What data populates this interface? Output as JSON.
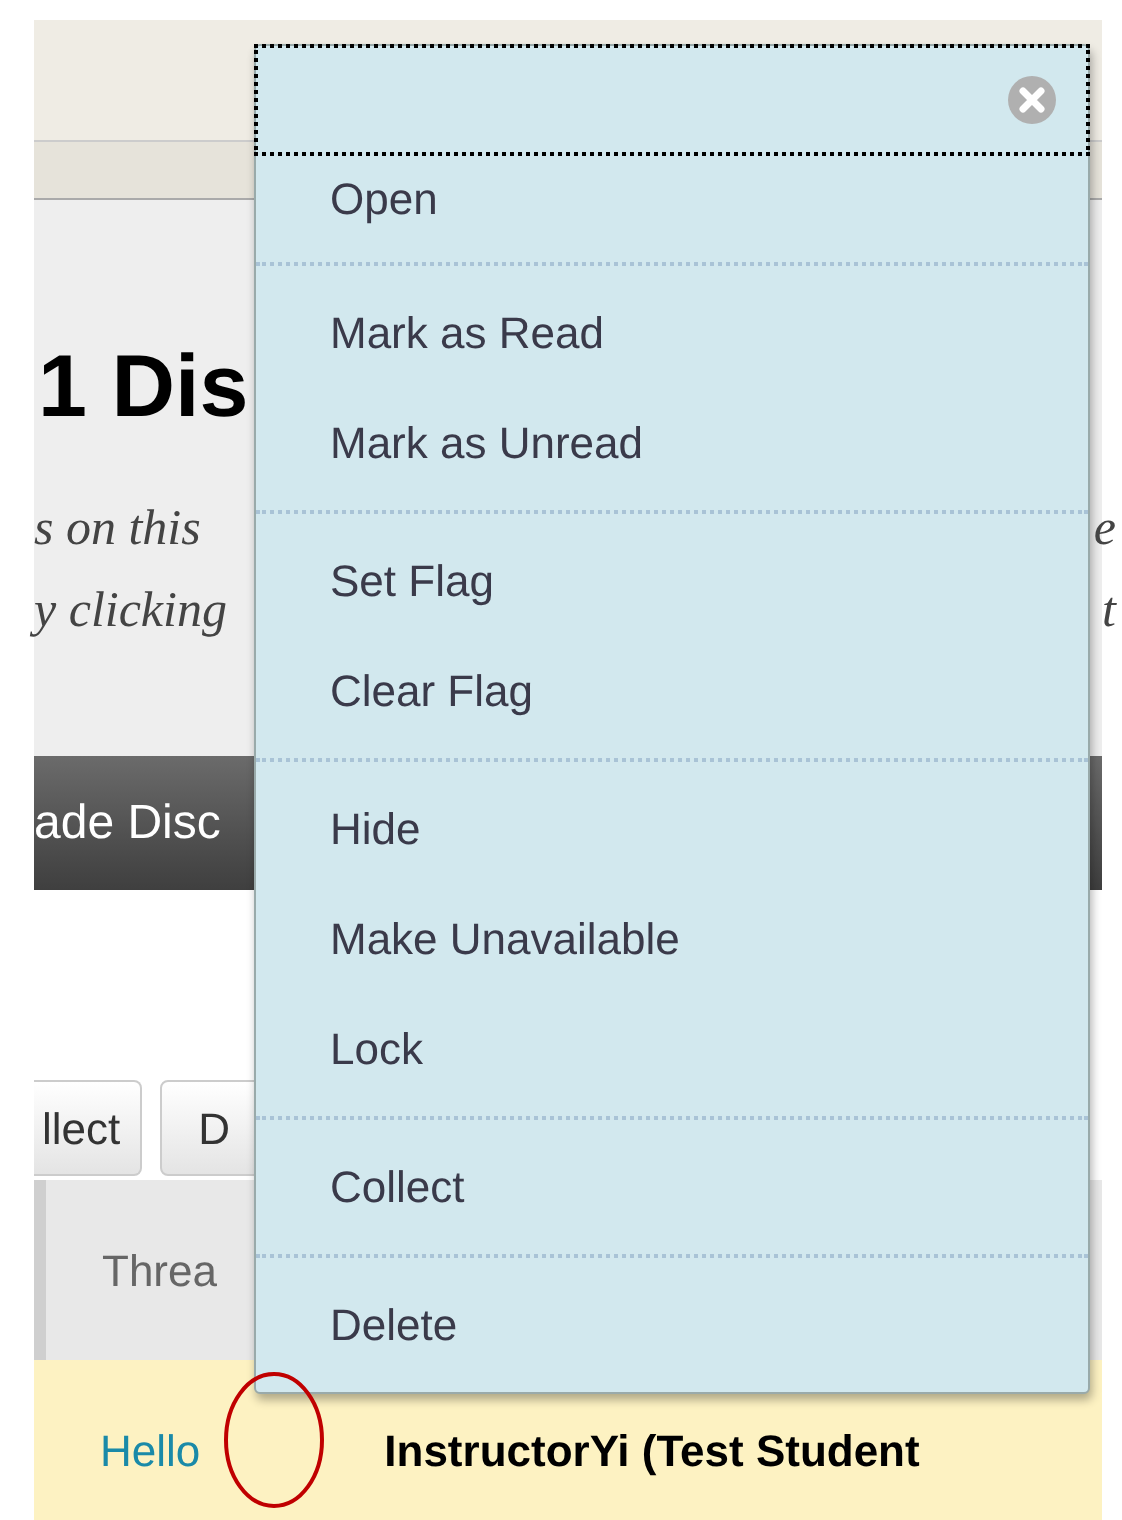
{
  "page": {
    "title": "1 Dis",
    "description_lines": [
      "s on this",
      "y clicking"
    ],
    "description_edge": [
      "e",
      "t"
    ],
    "action_bar": "ade Disc",
    "buttons": [
      "llect",
      "D"
    ],
    "table_header": "Threa",
    "row": {
      "link": "Hello",
      "author": "InstructorYi (Test Student"
    }
  },
  "menu": {
    "groups": [
      [
        {
          "label": "Open"
        }
      ],
      [
        {
          "label": "Mark as Read"
        },
        {
          "label": "Mark as Unread"
        }
      ],
      [
        {
          "label": "Set Flag"
        },
        {
          "label": "Clear Flag"
        }
      ],
      [
        {
          "label": "Hide"
        },
        {
          "label": "Make Unavailable"
        },
        {
          "label": "Lock"
        }
      ],
      [
        {
          "label": "Collect"
        }
      ],
      [
        {
          "label": "Delete"
        }
      ]
    ]
  }
}
